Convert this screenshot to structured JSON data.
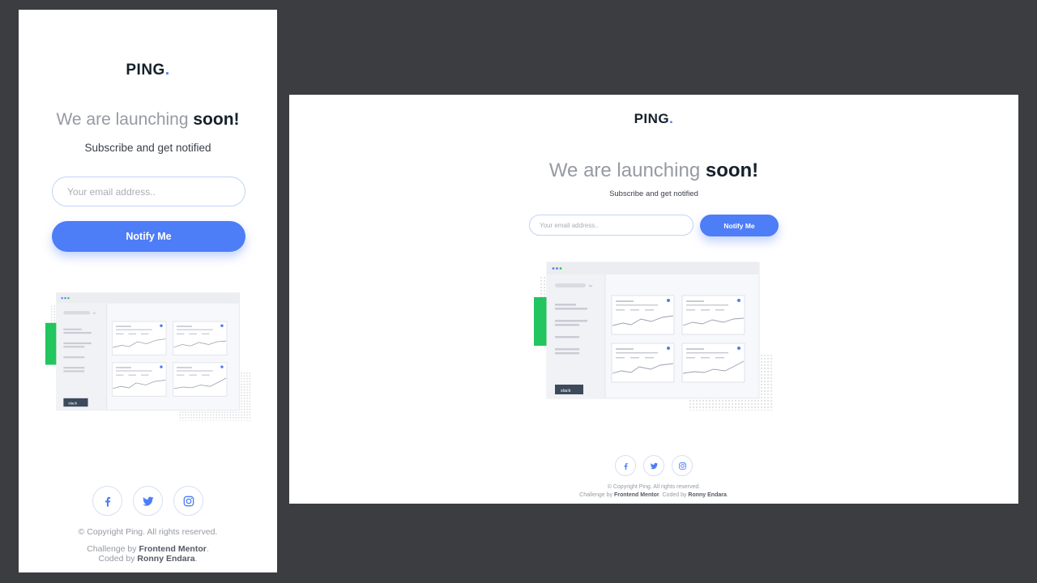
{
  "brand": {
    "name": "PING",
    "dot": ".",
    "accent_color": "#4d7df7"
  },
  "hero": {
    "headline_lead": "We are launching",
    "headline_emphasis": "soon!",
    "subtitle": "Subscribe and get notified"
  },
  "form": {
    "email_placeholder": "Your email address..",
    "button_label": "Notify Me"
  },
  "dashboard": {
    "slack_label": "slack"
  },
  "socials": [
    {
      "icon": "facebook-icon"
    },
    {
      "icon": "twitter-icon"
    },
    {
      "icon": "instagram-icon"
    }
  ],
  "footer": {
    "copyright": "© Copyright Ping. All rights reserved.",
    "challenge_lead": "Challenge by",
    "challenge_author": "Frontend Mentor",
    "challenge_end": ".",
    "coded_lead": "Coded by",
    "coded_author": "Ronny Endara",
    "coded_end": "."
  },
  "colors": {
    "background": "#3c3d40",
    "primary": "#4d7df7",
    "heading": "#15202a",
    "muted": "#969aa3",
    "green": "#22c55e"
  }
}
